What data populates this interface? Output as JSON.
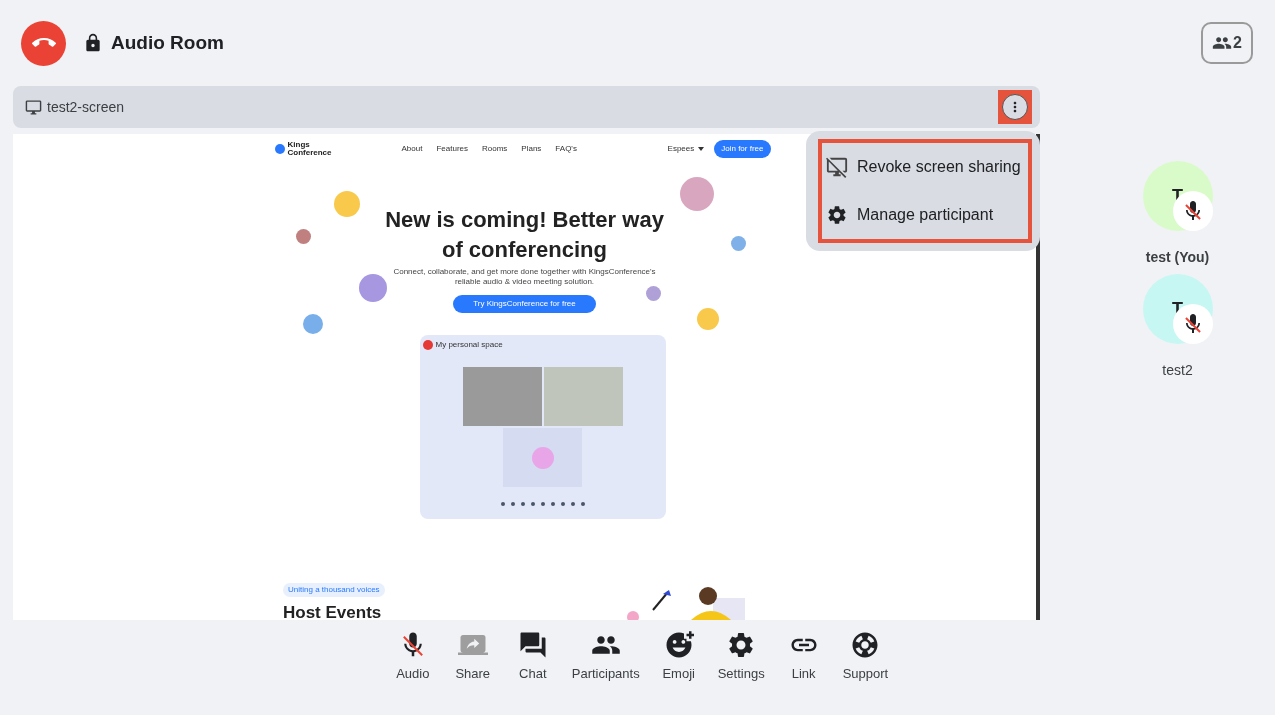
{
  "header": {
    "title": "Audio Room",
    "participant_count": "2"
  },
  "screen_share": {
    "title": "test2-screen",
    "more_highlighted": true,
    "page": {
      "brand": [
        "Kings",
        "Conference"
      ],
      "nav": [
        "About",
        "Features",
        "Rooms",
        "Plans",
        "FAQ's"
      ],
      "language": "Espees",
      "join": "Join for free",
      "headline": "New is coming! Better way of conferencing",
      "subtitle": "Connect, collaborate, and get more done together with KingsConference's reliable audio & video meeting solution.",
      "cta": "Try KingsConference for free",
      "preview_title": "My personal space",
      "tag": "Uniting a thousand voices",
      "section_heading": "Host Events"
    }
  },
  "menu": {
    "highlighted": true,
    "items": [
      {
        "kind": "revoke",
        "label": "Revoke screen sharing"
      },
      {
        "kind": "manage",
        "label": "Manage participant"
      }
    ]
  },
  "participants": [
    {
      "name": "test (You)",
      "initial": "T",
      "color": "#d9fbc9",
      "muted": true,
      "bold": true
    },
    {
      "name": "test2",
      "initial": "T",
      "color": "#c6f7f2",
      "muted": true,
      "bold": false
    }
  ],
  "toolbar": [
    {
      "kind": "audio",
      "label": "Audio",
      "muted": true,
      "disabled": false
    },
    {
      "kind": "share",
      "label": "Share",
      "disabled": true
    },
    {
      "kind": "chat",
      "label": "Chat",
      "disabled": false
    },
    {
      "kind": "participants",
      "label": "Participants",
      "disabled": false
    },
    {
      "kind": "emoji",
      "label": "Emoji",
      "disabled": false
    },
    {
      "kind": "settings",
      "label": "Settings",
      "disabled": false
    },
    {
      "kind": "link",
      "label": "Link",
      "disabled": false
    },
    {
      "kind": "support",
      "label": "Support",
      "disabled": false
    }
  ]
}
